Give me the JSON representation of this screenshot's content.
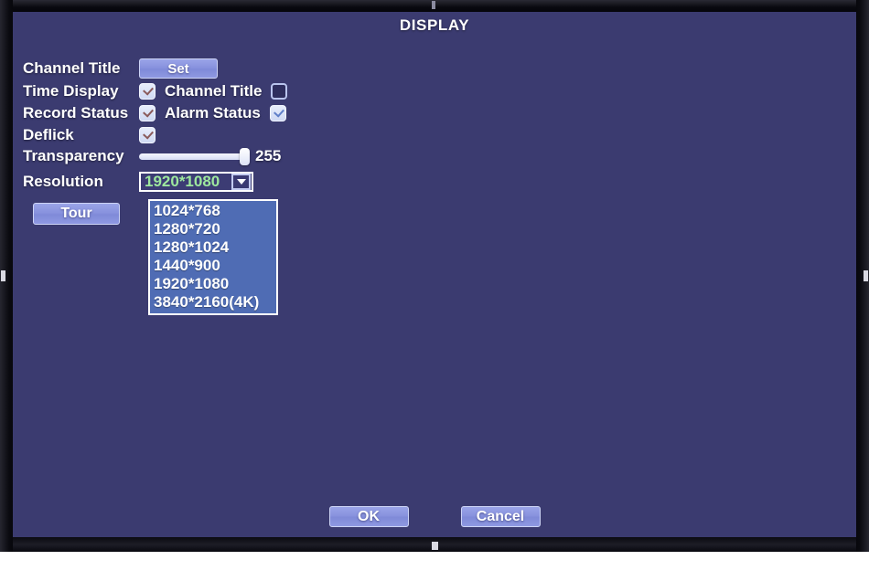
{
  "window": {
    "title": "DISPLAY"
  },
  "form": {
    "channel_title": {
      "label": "Channel Title",
      "set_button": "Set"
    },
    "time_display": {
      "label": "Time Display",
      "checked": true,
      "secondary_label": "Channel Title",
      "secondary_checked": false
    },
    "record_status": {
      "label": "Record Status",
      "checked": true,
      "secondary_label": "Alarm Status",
      "secondary_checked": true
    },
    "deflick": {
      "label": "Deflick",
      "checked": true
    },
    "transparency": {
      "label": "Transparency",
      "value": "255",
      "min": "0",
      "max": "255"
    },
    "resolution": {
      "label": "Resolution",
      "value": "1920*1080",
      "options": [
        "1024*768",
        "1280*720",
        "1280*1024",
        "1440*900",
        "1920*1080",
        "3840*2160(4K)"
      ]
    },
    "tour_button": "Tour"
  },
  "footer": {
    "ok_label": "OK",
    "cancel_label": "Cancel"
  },
  "icons": {
    "dropdown_caret": "chevron-down-icon",
    "checkmark": "check-icon"
  },
  "colors": {
    "screen_bg": "#3b3b70",
    "accent_button": "#8892de",
    "value_text": "#9ee89e",
    "list_bg": "#4f6cb4",
    "bezel": "#0c0c12"
  }
}
